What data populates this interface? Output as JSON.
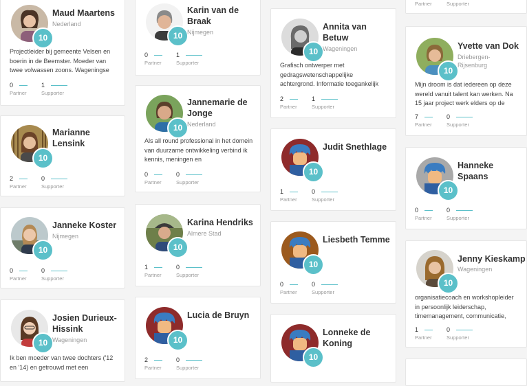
{
  "badge_color": "#5bc0c9",
  "stat_labels": {
    "partner": "Partner",
    "supporter": "Supporter"
  },
  "badge_value": "10",
  "cards": {
    "maud": {
      "name": "Maud Maartens",
      "location": "Nederland",
      "desc": "Projectleider bij gemeente Velsen en boerin in de Beemster. Moeder van twee volwassen zoons. Wageningse",
      "partner": "0",
      "supporter": "1"
    },
    "marianne": {
      "name": "Marianne Lensink",
      "location": "",
      "desc": "",
      "partner": "2",
      "supporter": "0"
    },
    "janneke": {
      "name": "Janneke Koster",
      "location": "Nijmegen",
      "desc": "",
      "partner": "0",
      "supporter": "0"
    },
    "josien": {
      "name": "Josien Durieux-Hissink",
      "location": "Wageningen",
      "desc": "Ik ben moeder van twee dochters ('12 en '14) en getrouwd met een",
      "partner": "",
      "supporter": ""
    },
    "karin": {
      "name": "Karin van de Braak",
      "location": "Nijmegen",
      "desc": "",
      "partner": "0",
      "supporter": "1"
    },
    "jannemarie": {
      "name": "Jannemarie de Jonge",
      "location": "Nederland",
      "desc": "Als all round professional in het domein van duurzame ontwikkeling verbind ik kennis, meningen en",
      "partner": "0",
      "supporter": "0"
    },
    "karina": {
      "name": "Karina Hendriks",
      "location": "Almere Stad",
      "desc": "",
      "partner": "1",
      "supporter": "0"
    },
    "lucia": {
      "name": "Lucia de Bruyn",
      "location": "",
      "desc": "",
      "partner": "2",
      "supporter": "0"
    },
    "annita": {
      "name": "Annita van Betuw",
      "location": "Wageningen",
      "desc": "Grafisch ontwerper met gedragswetenschappelijke achtergrond. Informatie toegankelijk",
      "partner": "2",
      "supporter": "1"
    },
    "judit": {
      "name": "Judit Snethlage",
      "location": "",
      "desc": "",
      "partner": "1",
      "supporter": "0"
    },
    "liesbeth": {
      "name": "Liesbeth Temme",
      "location": "",
      "desc": "",
      "partner": "0",
      "supporter": "0"
    },
    "lonneke": {
      "name": "Lonneke de Koning",
      "location": "",
      "desc": "",
      "partner": "",
      "supporter": ""
    },
    "top4": {
      "partner_label": "Partner",
      "supporter_label": "Supporter"
    },
    "yvette": {
      "name": "Yvette van Dok",
      "location": "Driebergen-Rijsenburg",
      "desc": "Mijn droom is dat iedereen op deze wereld vanuit talent kan werken. Na 15 jaar project werk elders op de",
      "partner": "7",
      "supporter": "0"
    },
    "hanneke": {
      "name": "Hanneke Spaans",
      "location": "",
      "desc": "",
      "partner": "0",
      "supporter": "0"
    },
    "jenny": {
      "name": "Jenny Kieskamp",
      "location": "Wageningen",
      "desc": "organisatiecoach en workshopleider in persoonlijk leiderschap, timemanagement, communicatie,",
      "partner": "1",
      "supporter": "0"
    }
  }
}
